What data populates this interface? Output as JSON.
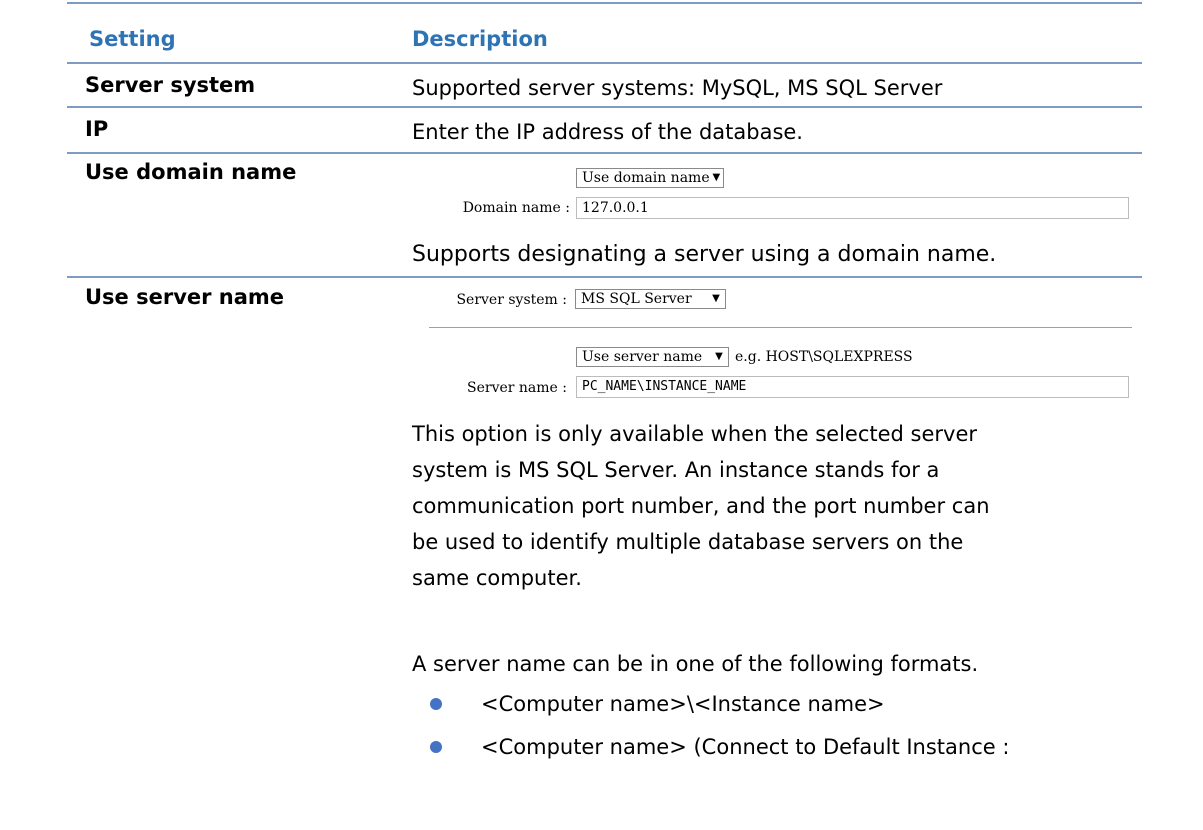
{
  "table": {
    "headers": {
      "setting": "Setting",
      "description": "Description"
    },
    "rows": [
      {
        "setting": "Server system",
        "description": "Supported server systems: MySQL, MS SQL Server"
      },
      {
        "setting": "IP",
        "description": "Enter the IP address of the database."
      },
      {
        "setting": "Use domain name",
        "dialog": {
          "mode_combo": "Use domain name",
          "domain_label": "Domain name :",
          "domain_value": "127.0.0.1"
        },
        "description": "Supports designating a server using a domain name."
      },
      {
        "setting": "Use server name",
        "dialog": {
          "server_system_label": "Server system :",
          "server_system_value": "MS SQL Server",
          "mode_combo": "Use server name",
          "hint": "e.g. HOST\\SQLEXPRESS",
          "server_name_label": "Server name :",
          "server_name_value": "PC_NAME\\INSTANCE_NAME"
        },
        "description_lines": [
          "This option is only available when the selected server",
          "system is MS SQL Server. An instance stands for a",
          "communication port number, and the port number can",
          "be used to identify multiple database servers on the",
          "same computer."
        ],
        "formats_intro": "A server name can be in one of the following formats.",
        "formats": [
          "<Computer name>\\<Instance name>",
          "<Computer name> (Connect to Default Instance :"
        ]
      }
    ]
  },
  "colors": {
    "header_text": "#2e74b5",
    "rule": "#7f9cc4",
    "bullet": "#4472c4"
  },
  "icons": {
    "combo_arrow": "chevron-down-icon",
    "bullet": "bullet-dot-icon"
  }
}
